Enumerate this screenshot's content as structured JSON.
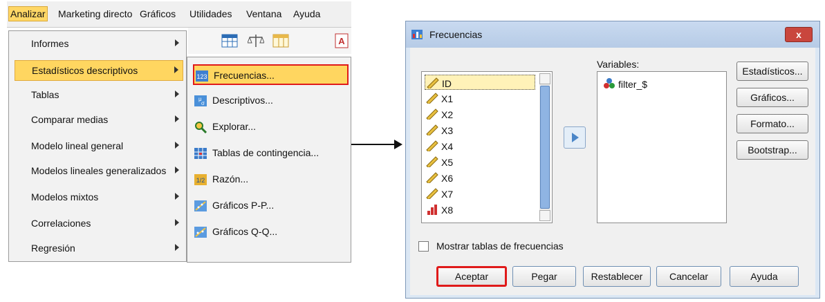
{
  "menubar": {
    "items": [
      "Analizar",
      "Marketing directo",
      "Gráficos",
      "Utilidades",
      "Ventana",
      "Ayuda"
    ],
    "active": "Analizar"
  },
  "analyze_menu": {
    "items": [
      "Informes",
      "Estadísticos descriptivos",
      "Tablas",
      "Comparar medias",
      "Modelo lineal general",
      "Modelos lineales generalizados",
      "Modelos mixtos",
      "Correlaciones",
      "Regresión"
    ],
    "highlighted": "Estadísticos descriptivos"
  },
  "descriptives_submenu": {
    "items": [
      {
        "label": "Frecuencias...",
        "icon": "frequencies-icon"
      },
      {
        "label": "Descriptivos...",
        "icon": "descriptives-icon"
      },
      {
        "label": "Explorar...",
        "icon": "explore-icon"
      },
      {
        "label": "Tablas de contingencia...",
        "icon": "crosstabs-icon"
      },
      {
        "label": "Razón...",
        "icon": "ratio-icon"
      },
      {
        "label": "Gráficos P-P...",
        "icon": "pp-plot-icon"
      },
      {
        "label": "Gráficos Q-Q...",
        "icon": "qq-plot-icon"
      }
    ],
    "highlighted": "Frecuencias..."
  },
  "dialog": {
    "title": "Frecuencias",
    "close_label": "x",
    "variables_label": "Variables:",
    "source_vars": [
      "ID",
      "X1",
      "X2",
      "X3",
      "X4",
      "X5",
      "X6",
      "X7",
      "X8"
    ],
    "selected_source": "ID",
    "target_vars": [
      "filter_$"
    ],
    "side_buttons": [
      "Estadísticos...",
      "Gráficos...",
      "Formato...",
      "Bootstrap..."
    ],
    "checkbox_label": "Mostrar tablas de frecuencias",
    "checkbox_checked": false,
    "buttons": [
      "Aceptar",
      "Pegar",
      "Restablecer",
      "Cancelar",
      "Ayuda"
    ]
  },
  "colors": {
    "highlight": "#ffd660",
    "callout_red": "#e01a1a",
    "dialog_blue": "#dbe7f4"
  }
}
